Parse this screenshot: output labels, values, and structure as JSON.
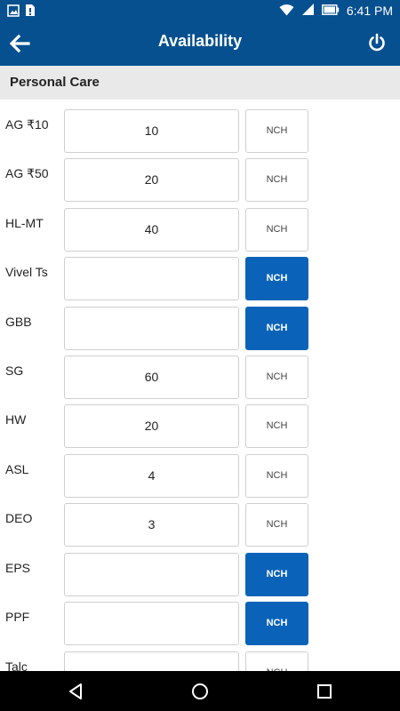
{
  "status_bar": {
    "time": "6:41 PM",
    "left_icons": [
      "image-icon",
      "sim-card-icon"
    ],
    "right_icons": [
      "wifi-icon",
      "signal-icon",
      "battery-icon"
    ]
  },
  "app_bar": {
    "title": "Availability",
    "back_icon": "arrow-left-icon",
    "power_icon": "power-icon"
  },
  "section": {
    "title": "Personal Care"
  },
  "rows": [
    {
      "label": "AG ₹10",
      "qty": "10",
      "nch_label": "NCH",
      "nch_selected": false
    },
    {
      "label": "AG ₹50",
      "qty": "20",
      "nch_label": "NCH",
      "nch_selected": false
    },
    {
      "label": "HL-MT",
      "qty": "40",
      "nch_label": "NCH",
      "nch_selected": false
    },
    {
      "label": "Vivel Ts",
      "qty": "",
      "nch_label": "NCH",
      "nch_selected": true
    },
    {
      "label": "GBB",
      "qty": "",
      "nch_label": "NCH",
      "nch_selected": true
    },
    {
      "label": "SG",
      "qty": "60",
      "nch_label": "NCH",
      "nch_selected": false
    },
    {
      "label": "HW",
      "qty": "20",
      "nch_label": "NCH",
      "nch_selected": false
    },
    {
      "label": "ASL",
      "qty": "4",
      "nch_label": "NCH",
      "nch_selected": false
    },
    {
      "label": "DEO",
      "qty": "3",
      "nch_label": "NCH",
      "nch_selected": false
    },
    {
      "label": "EPS",
      "qty": "",
      "nch_label": "NCH",
      "nch_selected": true
    },
    {
      "label": "PPF",
      "qty": "",
      "nch_label": "NCH",
      "nch_selected": true
    },
    {
      "label": "Talc",
      "qty": "",
      "nch_label": "NCH",
      "nch_selected": false
    }
  ],
  "nav_bar": {
    "icons": [
      "back-triangle-icon",
      "home-circle-icon",
      "recents-square-icon"
    ]
  },
  "colors": {
    "primary": "#06508f",
    "nch_selected": "#0a63b8",
    "section_bg": "#e9e9e9"
  }
}
